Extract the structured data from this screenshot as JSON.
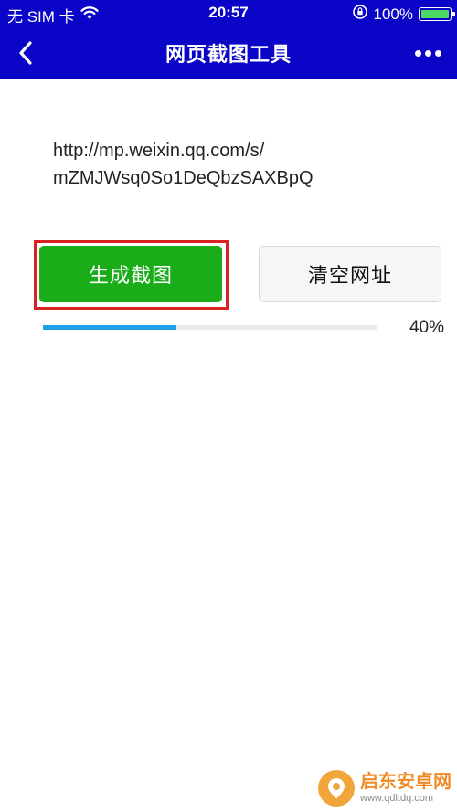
{
  "status_bar": {
    "carrier": "无 SIM 卡",
    "time": "20:57",
    "battery_percent": "100%",
    "battery_level": 1.0,
    "icons": [
      "wifi-icon",
      "rotation-lock-icon",
      "battery-icon"
    ]
  },
  "nav": {
    "title": "网页截图工具",
    "back_icon": "chevron-left-icon",
    "more_icon": "more-dots-icon"
  },
  "url": {
    "line1": "http://mp.weixin.qq.com/s/",
    "line2": "mZMJWsq0So1DeQbzSAXBpQ"
  },
  "buttons": {
    "generate_label": "生成截图",
    "clear_label": "清空网址"
  },
  "progress": {
    "value": 0.4,
    "label": "40%"
  },
  "watermark": {
    "name": "启东安卓网",
    "url": "www.qdltdq.com"
  },
  "colors": {
    "header_bg": "#0b06c7",
    "primary_button": "#1aad19",
    "highlight_border": "#d72323",
    "progress_fill": "#1e9fe8",
    "battery_fill": "#4cd964"
  }
}
